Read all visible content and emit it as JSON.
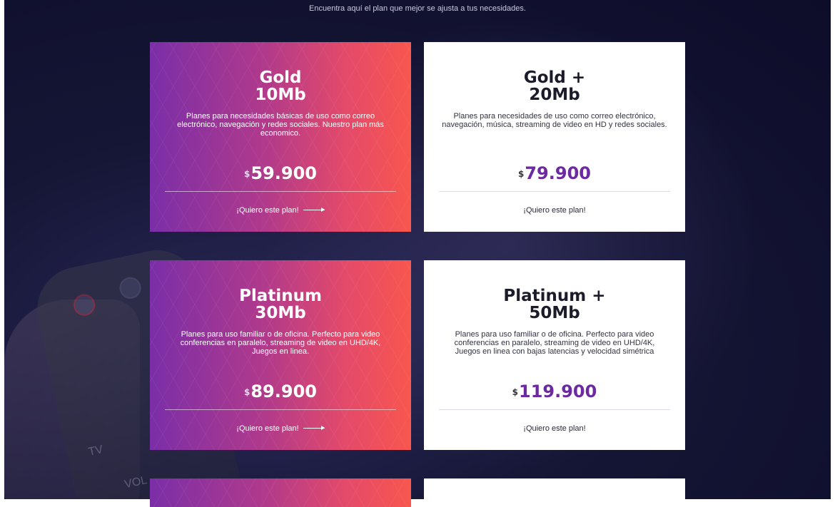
{
  "header": {
    "subtitle": "Encuentra aquí el plan que mejor se ajusta a tus necesidades."
  },
  "background": {
    "remote_labels": [
      "TV",
      "VOL"
    ]
  },
  "colors": {
    "gradient_start": "#7a2ea8",
    "gradient_end": "#f8564e",
    "price_purple": "#6b2aa0",
    "page_bg": "#151535"
  },
  "plans": [
    {
      "title_line1": "Gold",
      "title_line2": "10Mb",
      "description": "Planes para necesidades básicas de uso como correo electrónico, navegación y redes sociales. Nuestro plan más economico.",
      "currency": "$",
      "price": "59.900",
      "cta": "¡Quiero este plan!",
      "style": "gradient",
      "cta_icon": "arrow-right-icon"
    },
    {
      "title_line1": "Gold +",
      "title_line2": "20Mb",
      "description": "Planes para necesidades de uso como correo electrónico, navegación, música, streaming de video en HD y redes sociales.",
      "currency": "$",
      "price": "79.900",
      "cta": "¡Quiero este plan!",
      "style": "white"
    },
    {
      "title_line1": "Platinum",
      "title_line2": "30Mb",
      "description": "Planes para uso familiar o de oficina. Perfecto para video conferencias en paralelo, streaming de video en UHD/4K, Juegos en linea.",
      "currency": "$",
      "price": "89.900",
      "cta": "¡Quiero este plan!",
      "style": "gradient",
      "cta_icon": "arrow-right-icon"
    },
    {
      "title_line1": "Platinum +",
      "title_line2": "50Mb",
      "description": "Planes para uso familiar o de oficina. Perfecto para video conferencias en paralelo, streaming de video en UHD/4K, Juegos en linea con bajas latencias y velocidad simétrica",
      "currency": "$",
      "price": "119.900",
      "cta": "¡Quiero este plan!",
      "style": "white"
    }
  ]
}
